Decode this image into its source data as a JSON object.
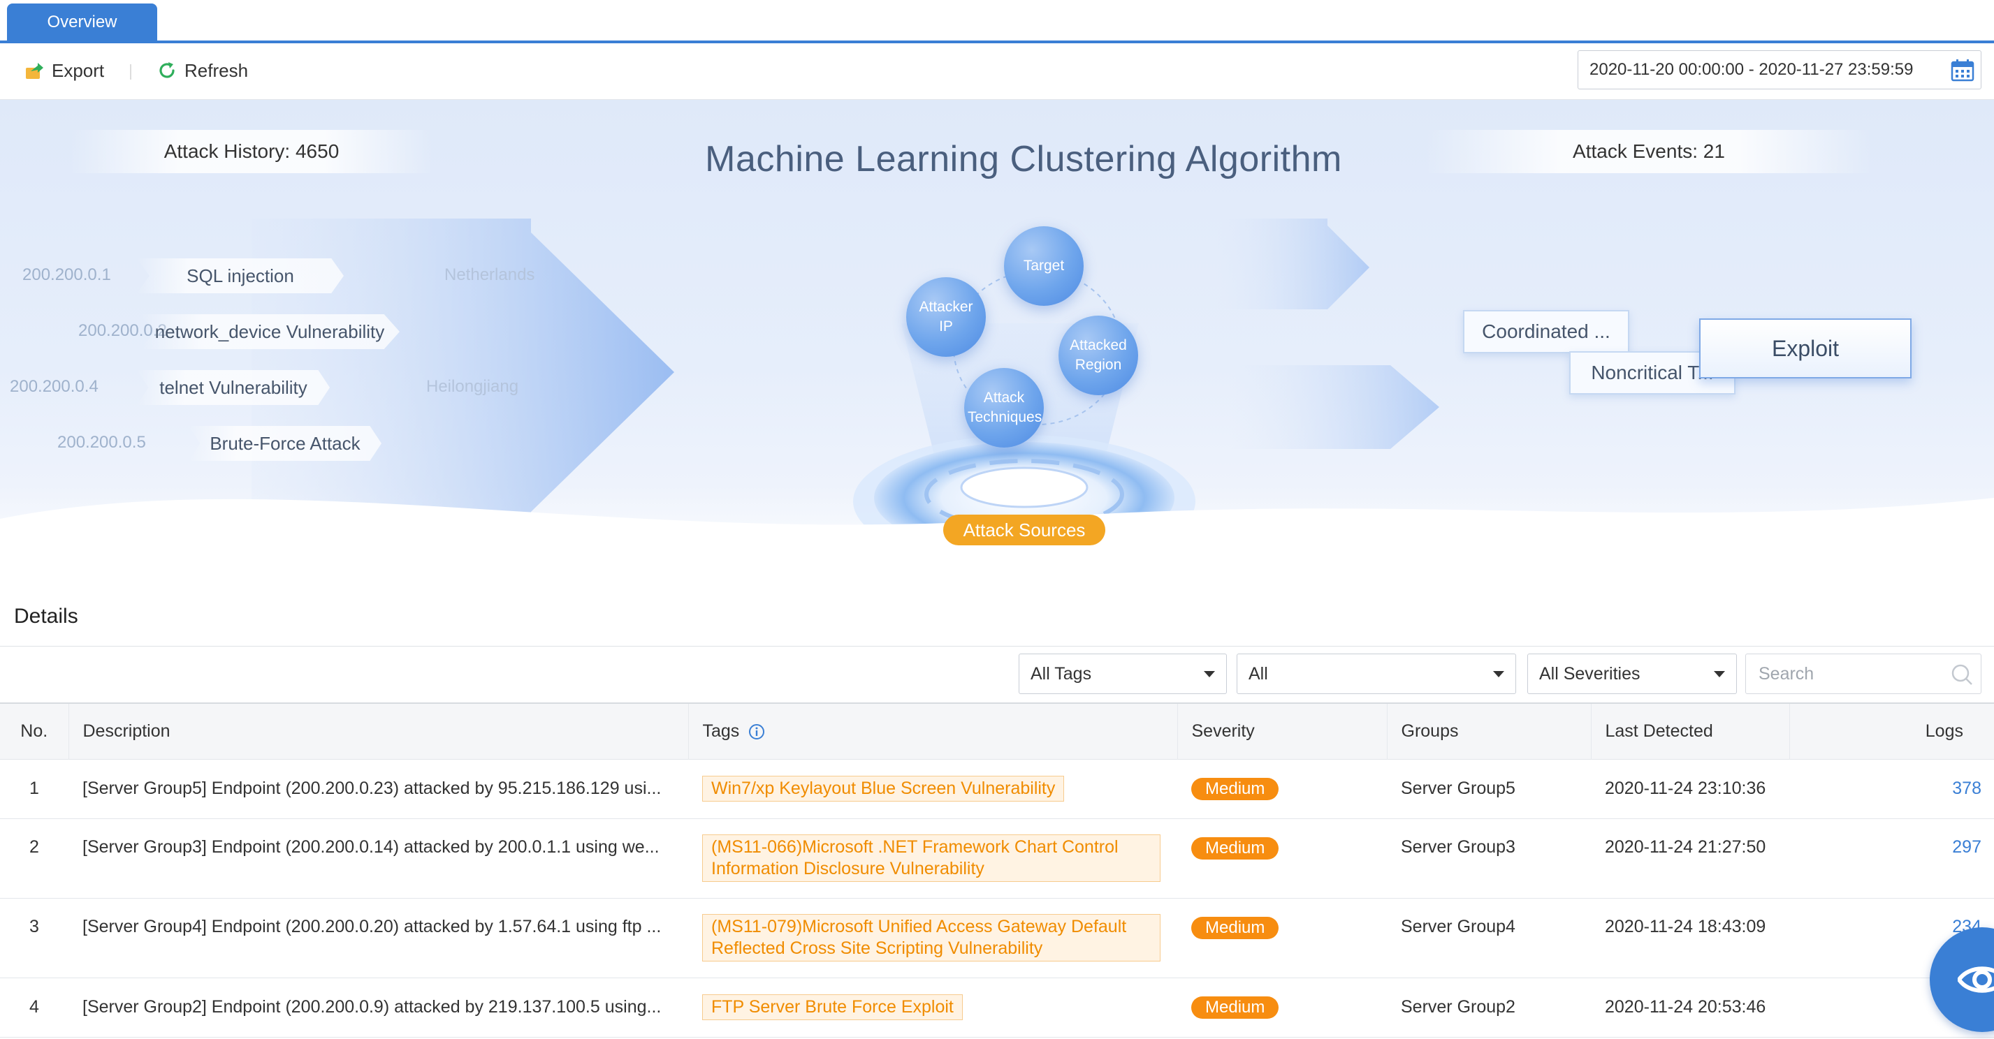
{
  "tabs": [
    {
      "label": "Overview"
    }
  ],
  "toolbar": {
    "export_label": "Export",
    "refresh_label": "Refresh",
    "date_range": "2020-11-20 00:00:00 - 2020-11-27 23:59:59"
  },
  "hero": {
    "attack_history_label": "Attack History: 4650",
    "attack_events_label": "Attack Events: 21",
    "title": "Machine Learning Clustering Algorithm",
    "flows": [
      {
        "ip": "200.200.0.1",
        "technique": "SQL injection",
        "region": "Netherlands"
      },
      {
        "ip": "200.200.0.2",
        "technique": "network_device Vulnerability",
        "region": ""
      },
      {
        "ip": "200.200.0.4",
        "technique": "telnet Vulnerability",
        "region": "Heilongjiang"
      },
      {
        "ip": "200.200.0.5",
        "technique": "Brute-Force Attack",
        "region": ""
      }
    ],
    "circles": {
      "target": "Target",
      "attacker_ip": "Attacker IP",
      "attacked_region": "Attacked Region",
      "attack_techniques": "Attack Techniques"
    },
    "sources_label": "Attack Sources",
    "events": {
      "coordinated": "Coordinated ...",
      "noncritical": "Noncritical T...",
      "exploit": "Exploit"
    }
  },
  "details": {
    "title": "Details",
    "filters": {
      "tags": "All Tags",
      "type": "All",
      "severity": "All Severities",
      "search_placeholder": "Search"
    },
    "columns": {
      "no": "No.",
      "description": "Description",
      "tags": "Tags",
      "severity": "Severity",
      "groups": "Groups",
      "last_detected": "Last Detected",
      "logs": "Logs"
    },
    "rows": [
      {
        "no": "1",
        "description": "[Server Group5] Endpoint (200.200.0.23) attacked by 95.215.186.129 usi...",
        "tag": "Win7/xp Keylayout Blue Screen Vulnerability",
        "severity": "Medium",
        "group": "Server Group5",
        "last_detected": "2020-11-24 23:10:36",
        "logs": "378"
      },
      {
        "no": "2",
        "description": "[Server Group3] Endpoint (200.200.0.14) attacked by 200.0.1.1 using we...",
        "tag": "(MS11-066)Microsoft .NET Framework Chart Control Information Disclosure Vulnerability",
        "severity": "Medium",
        "group": "Server Group3",
        "last_detected": "2020-11-24 21:27:50",
        "logs": "297"
      },
      {
        "no": "3",
        "description": "[Server Group4] Endpoint (200.200.0.20) attacked by 1.57.64.1 using ftp ...",
        "tag": "(MS11-079)Microsoft Unified Access Gateway Default Reflected Cross Site Scripting Vulnerability",
        "severity": "Medium",
        "group": "Server Group4",
        "last_detected": "2020-11-24 18:43:09",
        "logs": "234"
      },
      {
        "no": "4",
        "description": "[Server Group2] Endpoint (200.200.0.9) attacked by 219.137.100.5 using...",
        "tag": "FTP Server Brute Force Exploit",
        "severity": "Medium",
        "group": "Server Group2",
        "last_detected": "2020-11-24 20:53:46",
        "logs": ""
      }
    ]
  },
  "colors": {
    "accent": "#3a7fd5",
    "severity_medium": "#f78d10",
    "tag_text": "#f08c00",
    "attack_sources": "#f3a623"
  }
}
